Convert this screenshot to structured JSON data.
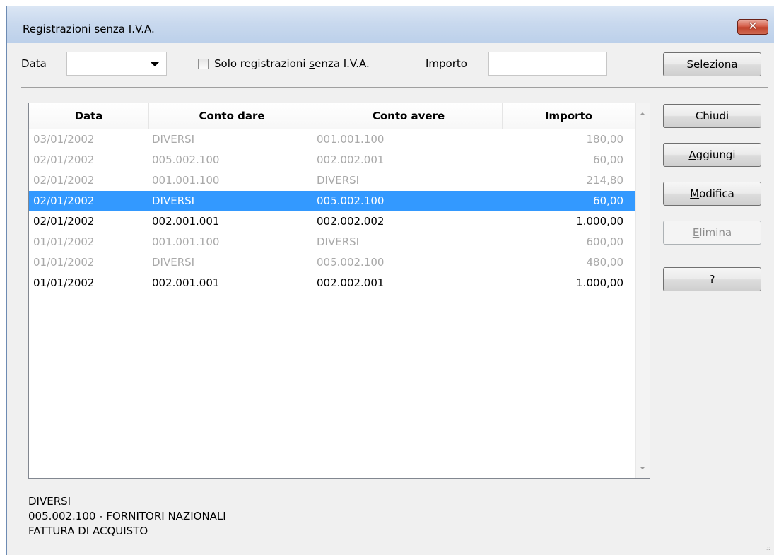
{
  "window": {
    "title": "Registrazioni senza I.V.A.",
    "close_label": "✕"
  },
  "filters": {
    "data_label": "Data",
    "data_value": "",
    "solo_label_before": "Solo registrazioni ",
    "solo_label_underline": "s",
    "solo_label_after": "enza I.V.A.",
    "solo_checked": false,
    "importo_label": "Importo",
    "importo_value": ""
  },
  "buttons": {
    "seleziona": "Seleziona",
    "chiudi": "Chiudi",
    "aggiungi_u": "A",
    "aggiungi_rest": "ggiungi",
    "modifica_u": "M",
    "modifica_rest": "odifica",
    "elimina_u": "E",
    "elimina_rest": "limina",
    "help": "?"
  },
  "table": {
    "columns": [
      "Data",
      "Conto dare",
      "Conto avere",
      "Importo"
    ],
    "rows": [
      {
        "data": "03/01/2002",
        "dare": "DIVERSI",
        "avere": "001.001.100",
        "importo": "180,00",
        "state": "dim"
      },
      {
        "data": "02/01/2002",
        "dare": "005.002.100",
        "avere": "002.002.001",
        "importo": "60,00",
        "state": "dim"
      },
      {
        "data": "02/01/2002",
        "dare": "001.001.100",
        "avere": "DIVERSI",
        "importo": "214,80",
        "state": "dim"
      },
      {
        "data": "02/01/2002",
        "dare": "DIVERSI",
        "avere": "005.002.100",
        "importo": "60,00",
        "state": "selected"
      },
      {
        "data": "02/01/2002",
        "dare": "002.001.001",
        "avere": "002.002.002",
        "importo": "1.000,00",
        "state": "normal"
      },
      {
        "data": "01/01/2002",
        "dare": "001.001.100",
        "avere": "DIVERSI",
        "importo": "600,00",
        "state": "dim"
      },
      {
        "data": "01/01/2002",
        "dare": "DIVERSI",
        "avere": "005.002.100",
        "importo": "480,00",
        "state": "dim"
      },
      {
        "data": "01/01/2002",
        "dare": "002.001.001",
        "avere": "002.002.001",
        "importo": "1.000,00",
        "state": "normal"
      }
    ]
  },
  "details": {
    "line1": "DIVERSI",
    "line2": "005.002.100 - FORNITORI NAZIONALI",
    "line3": "FATTURA DI ACQUISTO"
  }
}
